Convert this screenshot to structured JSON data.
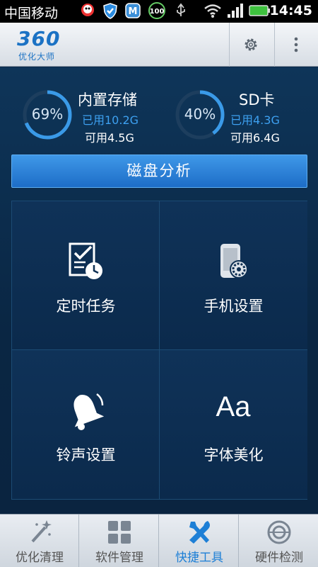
{
  "status_bar": {
    "carrier": "中国移动",
    "time": "14:45"
  },
  "header": {
    "logo_main": "360",
    "logo_sub": "优化大师"
  },
  "storage": {
    "internal": {
      "title": "内置存储",
      "percent": "69%",
      "percent_value": 0.69,
      "used": "已用10.2G",
      "available": "可用4.5G"
    },
    "sd": {
      "title": "SD卡",
      "percent": "40%",
      "percent_value": 0.4,
      "used": "已用4.3G",
      "available": "可用6.4G"
    }
  },
  "disk_analysis_label": "磁盘分析",
  "tools": [
    {
      "label": "定时任务",
      "icon": "scheduled-task-icon"
    },
    {
      "label": "手机设置",
      "icon": "phone-settings-icon"
    },
    {
      "label": "铃声设置",
      "icon": "bell-icon"
    },
    {
      "label": "字体美化",
      "icon": "font-icon",
      "glyph": "Aa"
    }
  ],
  "tabs": [
    {
      "label": "优化清理",
      "icon": "magic-wand-icon",
      "active": false
    },
    {
      "label": "软件管理",
      "icon": "apps-grid-icon",
      "active": false
    },
    {
      "label": "快捷工具",
      "icon": "tools-icon",
      "active": true
    },
    {
      "label": "硬件检测",
      "icon": "hardware-check-icon",
      "active": false
    }
  ],
  "colors": {
    "accent_blue": "#1d7fd6",
    "used_text": "#3da0f0",
    "background": "#0b2a4a"
  }
}
